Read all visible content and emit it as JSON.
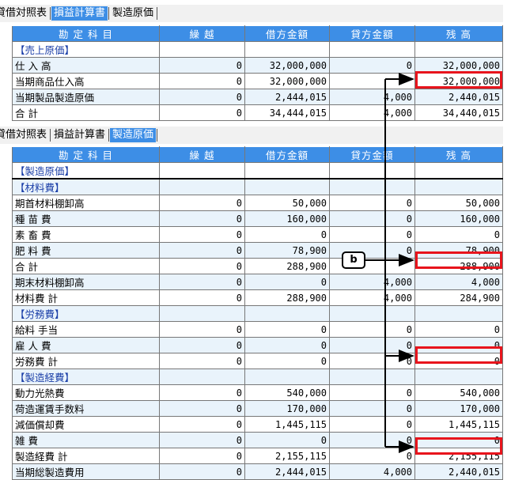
{
  "top_tabs": {
    "items": [
      "貸借対照表",
      "損益計算書",
      "製造原価"
    ],
    "active": 1
  },
  "top_table": {
    "headers": [
      "勘 定 科 目",
      "繰 越",
      "借方金額",
      "貸方金額",
      "残 高"
    ],
    "rows": [
      {
        "label": "【売上原価】",
        "section": true,
        "values": [
          "",
          "",
          "",
          ""
        ]
      },
      {
        "label": "仕 入 高",
        "values": [
          "0",
          "32,000,000",
          "0",
          "32,000,000"
        ]
      },
      {
        "label": "当期商品仕入高",
        "values": [
          "0",
          "32,000,000",
          "",
          "32,000,000"
        ]
      },
      {
        "label": "当期製品製造原価",
        "values": [
          "0",
          "2,444,015",
          "4,000",
          "2,440,015"
        ]
      },
      {
        "label": "合 計",
        "values": [
          "0",
          "34,444,015",
          "4,000",
          "34,440,015"
        ]
      }
    ]
  },
  "bottom_tabs": {
    "items": [
      "貸借対照表",
      "損益計算書",
      "製造原価"
    ],
    "active": 2
  },
  "bottom_table": {
    "headers": [
      "勘 定 科 目",
      "繰 越",
      "借方金額",
      "貸方金額",
      "残 高"
    ],
    "rows": [
      {
        "label": "【製造原価】",
        "section": true,
        "values": [
          "",
          "",
          "",
          ""
        ]
      },
      {
        "label": "【材料費】",
        "section": true,
        "values": [
          "",
          "",
          "",
          ""
        ]
      },
      {
        "label": "期首材料棚卸高",
        "values": [
          "0",
          "50,000",
          "0",
          "50,000"
        ]
      },
      {
        "label": "種 苗 費",
        "values": [
          "0",
          "160,000",
          "0",
          "160,000"
        ]
      },
      {
        "label": "素 畜 費",
        "values": [
          "0",
          "0",
          "0",
          "0"
        ]
      },
      {
        "label": "肥 料 費",
        "values": [
          "0",
          "78,900",
          "0",
          "78,900"
        ]
      },
      {
        "label": "合 計",
        "values": [
          "0",
          "288,900",
          "",
          "288,900"
        ]
      },
      {
        "label": "期末材料棚卸高",
        "values": [
          "0",
          "0",
          "4,000",
          "4,000"
        ]
      },
      {
        "label": "材料費 計",
        "values": [
          "0",
          "288,900",
          "4,000",
          "284,900"
        ]
      },
      {
        "label": "【労務費】",
        "section": true,
        "values": [
          "",
          "",
          "",
          ""
        ]
      },
      {
        "label": "給料 手当",
        "values": [
          "0",
          "0",
          "0",
          "0"
        ]
      },
      {
        "label": "雇 人 費",
        "values": [
          "0",
          "0",
          "0",
          "0"
        ]
      },
      {
        "label": "労務費 計",
        "values": [
          "0",
          "0",
          "0",
          "0"
        ]
      },
      {
        "label": "【製造経費】",
        "section": true,
        "values": [
          "",
          "",
          "",
          ""
        ]
      },
      {
        "label": "動力光熱費",
        "values": [
          "0",
          "540,000",
          "0",
          "540,000"
        ]
      },
      {
        "label": "荷造運賃手数料",
        "values": [
          "0",
          "170,000",
          "0",
          "170,000"
        ]
      },
      {
        "label": "減価償却費",
        "values": [
          "0",
          "1,445,115",
          "0",
          "1,445,115"
        ]
      },
      {
        "label": "雑 費",
        "values": [
          "0",
          "0",
          "0",
          "0"
        ]
      },
      {
        "label": "製造経費 計",
        "values": [
          "0",
          "2,155,115",
          "0",
          "2,155,115"
        ]
      },
      {
        "label": "当期総製造費用",
        "values": [
          "0",
          "2,444,015",
          "4,000",
          "2,440,015"
        ]
      }
    ]
  },
  "annotation": {
    "label": "b"
  },
  "colors": {
    "header": "#3d8ee6",
    "stripe": "#e9f3fb",
    "highlight": "#e8141c"
  }
}
